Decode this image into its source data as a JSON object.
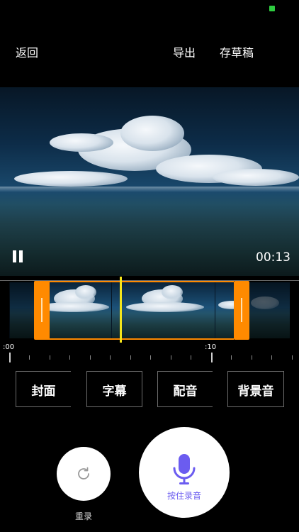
{
  "header": {
    "back_label": "返回",
    "export_label": "导出",
    "draft_label": "存草稿"
  },
  "player": {
    "time": "00:13",
    "state": "playing",
    "pause_icon": "pause-icon"
  },
  "timeline": {
    "tick_start": ":00",
    "tick_ten": ":10",
    "handle_color": "#ff8a00",
    "playhead_color": "#f5e51b"
  },
  "tools": {
    "cover_label": "封面",
    "subtitle_label": "字幕",
    "dubbing_label": "配音",
    "bgm_label": "背景音"
  },
  "recorder": {
    "reset_label": "重录",
    "hold_label": "按住录音",
    "mic_color": "#6b5cf0",
    "reset_icon": "refresh-icon",
    "mic_icon": "microphone-icon"
  },
  "status": {
    "indicator_color": "#2ecc40"
  }
}
